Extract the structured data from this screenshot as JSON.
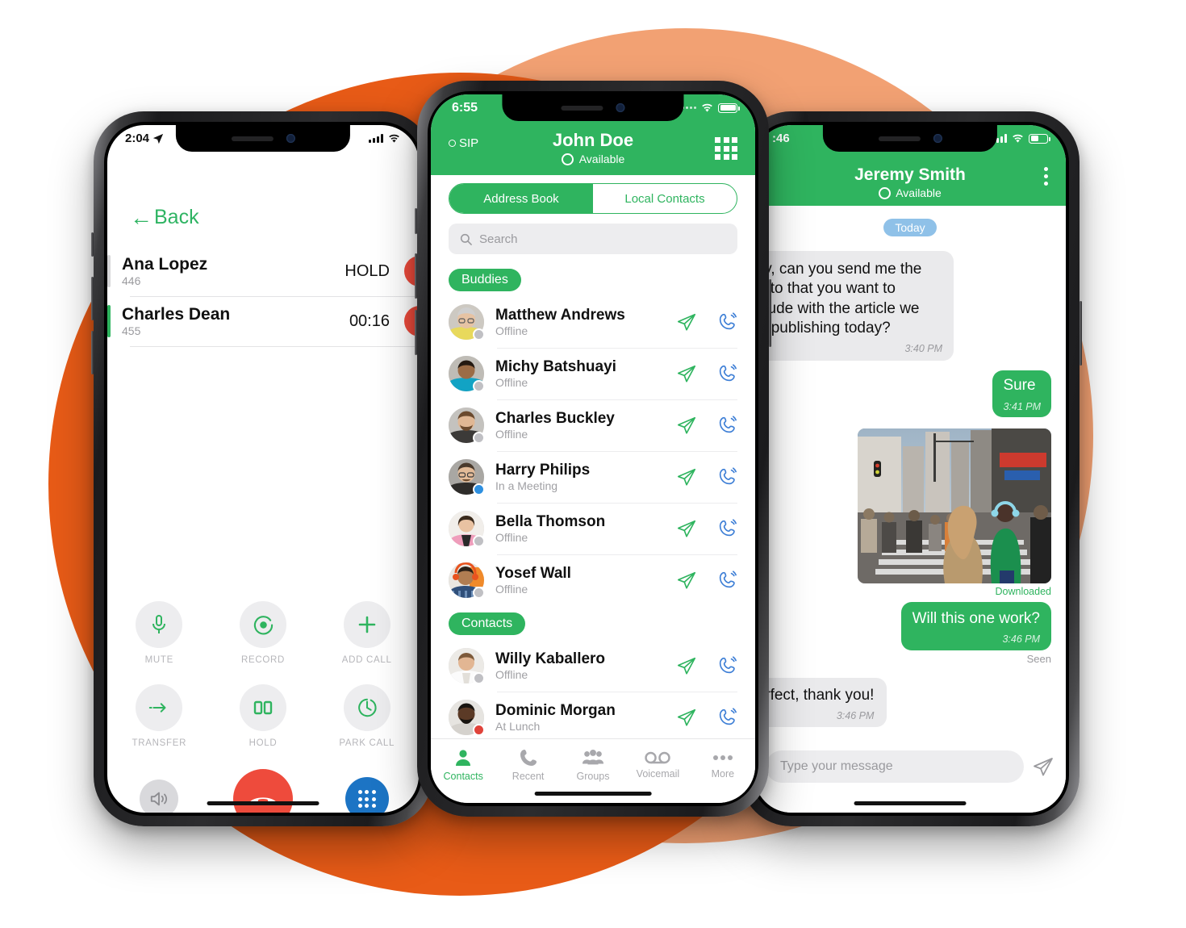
{
  "theme": {
    "green": "#2FB45F",
    "orange_dark": "#E85B17",
    "orange_light": "#F2A173",
    "blue": "#1C74C4",
    "red": "#EE4B3C"
  },
  "call_screen": {
    "status": {
      "time": "2:04",
      "location_icon": "location-arrow-icon"
    },
    "back_label": "Back",
    "calls": [
      {
        "name": "Ana Lopez",
        "ext": "446",
        "state": "HOLD",
        "active": false
      },
      {
        "name": "Charles Dean",
        "ext": "455",
        "state": "00:16",
        "active": true
      }
    ],
    "controls": [
      {
        "label": "MUTE",
        "icon": "microphone-icon"
      },
      {
        "label": "RECORD",
        "icon": "record-icon"
      },
      {
        "label": "ADD CALL",
        "icon": "plus-icon"
      },
      {
        "label": "TRANSFER",
        "icon": "transfer-arrow-icon"
      },
      {
        "label": "HOLD",
        "icon": "pause-icon"
      },
      {
        "label": "PARK CALL",
        "icon": "park-clock-icon"
      }
    ],
    "bottom": {
      "speaker": "speaker-icon",
      "end": "end-call-icon",
      "keypad": "keypad-icon"
    }
  },
  "contacts_screen": {
    "status": {
      "time": "6:55"
    },
    "sip_label": "SIP",
    "user_name": "John Doe",
    "presence": "Available",
    "keypad_icon": "keypad-grid-icon",
    "segments": [
      {
        "label": "Address Book",
        "selected": true
      },
      {
        "label": "Local Contacts",
        "selected": false
      }
    ],
    "search_placeholder": "Search",
    "groups": [
      {
        "title": "Buddies",
        "contacts": [
          {
            "name": "Matthew Andrews",
            "status": "Offline",
            "badge": "offline"
          },
          {
            "name": "Michy Batshuayi",
            "status": "Offline",
            "badge": "offline"
          },
          {
            "name": "Charles Buckley",
            "status": "Offline",
            "badge": "offline"
          },
          {
            "name": "Harry Philips",
            "status": "In a Meeting",
            "badge": "meeting"
          },
          {
            "name": "Bella Thomson",
            "status": "Offline",
            "badge": "offline"
          },
          {
            "name": "Yosef Wall",
            "status": "Offline",
            "badge": "offline"
          }
        ]
      },
      {
        "title": "Contacts",
        "contacts": [
          {
            "name": "Willy Kaballero",
            "status": "Offline",
            "badge": "offline"
          },
          {
            "name": "Dominic Morgan",
            "status": "At Lunch",
            "badge": "lunch"
          }
        ]
      }
    ],
    "row_actions": {
      "message": "send-message-icon",
      "call": "call-icon"
    },
    "tabs": [
      {
        "label": "Contacts",
        "icon": "person-icon",
        "active": true
      },
      {
        "label": "Recent",
        "icon": "phone-icon",
        "active": false
      },
      {
        "label": "Groups",
        "icon": "group-icon",
        "active": false
      },
      {
        "label": "Voicemail",
        "icon": "voicemail-icon",
        "active": false
      },
      {
        "label": "More",
        "icon": "ellipsis-icon",
        "active": false
      }
    ]
  },
  "chat_screen": {
    "status": {
      "time": ":46"
    },
    "contact_name": "Jeremy Smith",
    "presence": "Available",
    "menu_icon": "kebab-menu-icon",
    "day_divider": "Today",
    "messages": [
      {
        "dir": "in",
        "text": "Hey, can you send me the photo that you want to include with the article we are publishing today?",
        "time": "3:40 PM"
      },
      {
        "dir": "out",
        "text": "Sure",
        "time": "3:41 PM"
      },
      {
        "dir": "out",
        "type": "image",
        "caption": "Downloaded"
      },
      {
        "dir": "out",
        "text": "Will this one work?",
        "time": "3:46 PM",
        "receipt": "Seen"
      },
      {
        "dir": "in",
        "text": "Perfect, thank you!",
        "time": "3:46 PM"
      }
    ],
    "input_placeholder": "Type your message",
    "send_icon": "send-icon"
  }
}
